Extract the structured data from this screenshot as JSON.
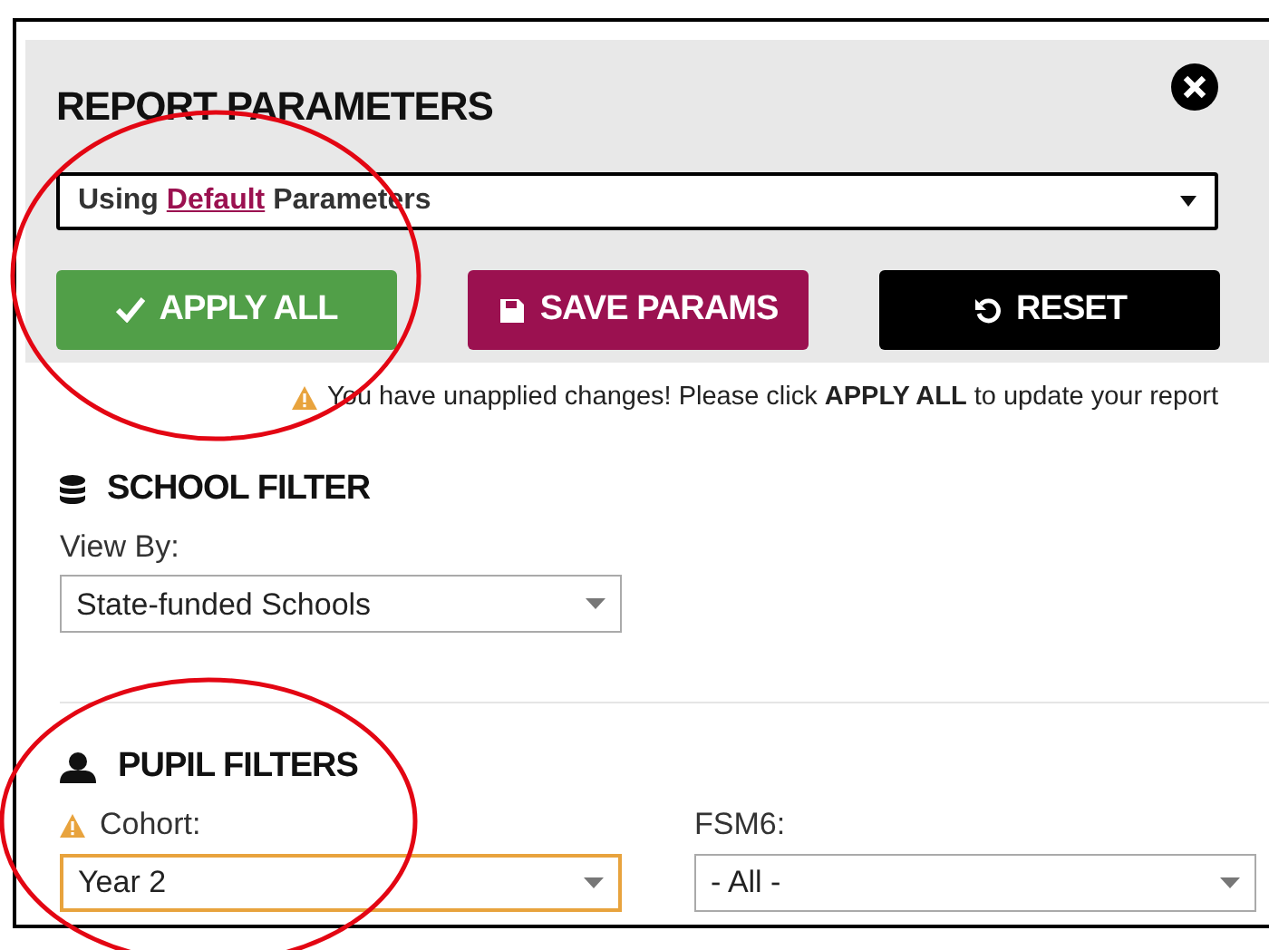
{
  "panel": {
    "title": "REPORT PARAMETERS"
  },
  "parameter_select": {
    "prefix": "Using",
    "link": "Default",
    "suffix": "Parameters"
  },
  "buttons": [
    {
      "kind": "apply",
      "label": "APPLY ALL"
    },
    {
      "kind": "save",
      "label": "SAVE PARAMS"
    },
    {
      "kind": "reset",
      "label": "RESET"
    }
  ],
  "warning": "You have unapplied changes! Please click **APPLY ALL** to update your report",
  "school_filter": {
    "title": "SCHOOL FILTER",
    "fields": [
      {
        "label": "View By:",
        "value": "State-funded Schools",
        "warning": false
      }
    ]
  },
  "pupil_filters": {
    "title": "PUPIL FILTERS",
    "fields": [
      {
        "label": "Cohort:",
        "value": "Year 2",
        "warning": true
      },
      {
        "label": "FSM6:",
        "value": "- All -",
        "warning": false
      }
    ]
  },
  "annotations": [
    {
      "kind": "circle"
    },
    {
      "kind": "circle"
    }
  ]
}
